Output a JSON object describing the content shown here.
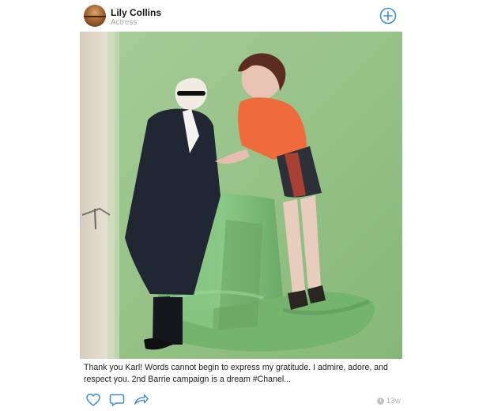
{
  "post": {
    "author_name": "Lily Collins",
    "author_role": "Actress",
    "caption": "Thank you Karl! Words cannot begin to express my gratitude. I admire, adore, and respect you. 2nd Barrie campaign is a dream #Chanel...",
    "age": "13w"
  },
  "icons": {
    "add": "add-circle-icon",
    "like": "heart-icon",
    "comment": "comment-icon",
    "share": "share-arrow-icon",
    "age": "clock-icon"
  },
  "colors": {
    "accent": "#3b8ed5",
    "photo_background": "#98c18f",
    "muted_text": "#a9a9a9"
  }
}
